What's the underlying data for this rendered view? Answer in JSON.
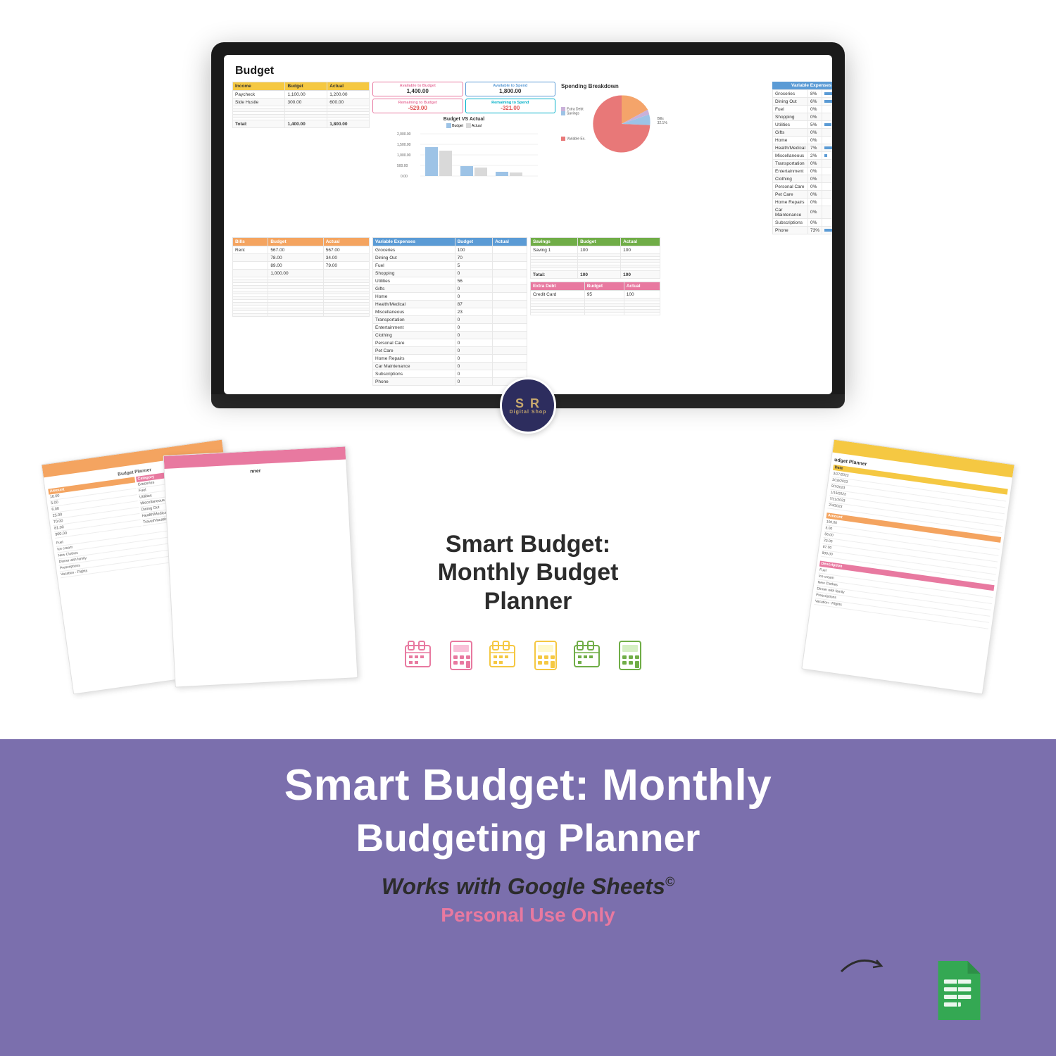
{
  "page": {
    "background": "#ffffff"
  },
  "banner": {
    "line1": "Smart Budget: Monthly",
    "line2": "Budgeting Planner",
    "italic": "Works with Google Sheets",
    "trademark": "©",
    "personal": "Personal Use Only"
  },
  "product_title": {
    "line1": "Smart Budget:",
    "line2": "Monthly Budget",
    "line3": "Planner"
  },
  "logo": {
    "initials": "S R",
    "subtitle": "Digital Shop"
  },
  "spreadsheet": {
    "title": "Budget",
    "income_table": {
      "headers": [
        "Income",
        "Budget",
        "Actual"
      ],
      "rows": [
        [
          "Paycheck",
          "1,100.00",
          "1,200.00"
        ],
        [
          "Side Hustle",
          "300.00",
          "600.00"
        ]
      ],
      "total": [
        "Total:",
        "1,400.00",
        "1,800.00"
      ]
    },
    "bills_table": {
      "headers": [
        "Bills",
        "Budget",
        "Actual"
      ],
      "rows": [
        [
          "Rent",
          "567.00",
          "567.00"
        ],
        [
          "",
          "78.00",
          "34.00"
        ],
        [
          "",
          "89.00",
          "79.00"
        ],
        [
          "",
          "1,000.00",
          ""
        ]
      ]
    },
    "variable_expenses": {
      "headers": [
        "Variable Expenses",
        "Budget",
        "Actual"
      ],
      "rows": [
        [
          "Groceries",
          "100",
          ""
        ],
        [
          "Dining Out",
          "70",
          ""
        ],
        [
          "Fuel",
          "5",
          ""
        ],
        [
          "Shopping",
          "0",
          ""
        ],
        [
          "Utilities",
          "56",
          ""
        ],
        [
          "Gifts",
          "0",
          ""
        ],
        [
          "Home",
          "0",
          ""
        ],
        [
          "Health/Medical",
          "87",
          ""
        ],
        [
          "Miscellaneous",
          "23",
          ""
        ],
        [
          "Transportation",
          "0",
          ""
        ],
        [
          "Entertainment",
          "0",
          ""
        ],
        [
          "Clothing",
          "0",
          ""
        ],
        [
          "Personal Care",
          "0",
          ""
        ],
        [
          "Pet Care",
          "0",
          ""
        ],
        [
          "Home Repairs",
          "0",
          ""
        ],
        [
          "Car Maintenance",
          "0",
          ""
        ],
        [
          "Subscriptions",
          "0",
          ""
        ],
        [
          "Phone",
          "0",
          ""
        ]
      ]
    },
    "savings_table": {
      "headers": [
        "Savings",
        "Budget",
        "Actual"
      ],
      "rows": [
        [
          "Saving 1",
          "100",
          "100"
        ]
      ],
      "total": [
        "Total:",
        "100",
        "100"
      ]
    },
    "extra_debt": {
      "headers": [
        "Extra Debt",
        "Budget",
        "Actual"
      ],
      "rows": [
        [
          "Credit Card",
          "95",
          "100"
        ]
      ]
    },
    "summary": {
      "available_to_budget_label": "Available to Budget",
      "available_to_budget_value": "1,400.00",
      "available_to_spend_label": "Available to Spend",
      "available_to_spend_value": "1,800.00",
      "remaining_to_budget_label": "Remaining to Budget",
      "remaining_to_budget_value": "-529.00",
      "remaining_to_spend_label": "Remaining to Spend",
      "remaining_to_spend_value": "-321.00"
    },
    "chart": {
      "title": "Budget VS Actual",
      "budget_label": "Budget",
      "actual_label": "Actual",
      "y_labels": [
        "2,000.00",
        "1,500.00",
        "1,000.00",
        "500.00",
        "0.00"
      ]
    },
    "pie_chart": {
      "title": "Spending Breakdown",
      "segments": [
        {
          "label": "Bills",
          "value": 32.1,
          "color": "#f4a46a"
        },
        {
          "label": "Variable Ex.",
          "value": 59.5,
          "color": "#e87878"
        },
        {
          "label": "Savings",
          "value": 4.7,
          "color": "#9dc3e6"
        },
        {
          "label": "Extra Debt",
          "value": 0.7,
          "color": "#c9b1d9"
        }
      ]
    },
    "var_breakdown": {
      "header": "Variable Expenses Breakdown",
      "rows": [
        {
          "label": "Groceries",
          "pct": "8%",
          "bar": 8
        },
        {
          "label": "Dining Out",
          "pct": "6%",
          "bar": 6
        },
        {
          "label": "Fuel",
          "pct": "0%",
          "bar": 0
        },
        {
          "label": "Shopping",
          "pct": "0%",
          "bar": 0
        },
        {
          "label": "Utilities",
          "pct": "5%",
          "bar": 5
        },
        {
          "label": "Gifts",
          "pct": "0%",
          "bar": 0
        },
        {
          "label": "Home",
          "pct": "0%",
          "bar": 0
        },
        {
          "label": "Health/Medical",
          "pct": "7%",
          "bar": 7
        },
        {
          "label": "Miscellaneous",
          "pct": "2%",
          "bar": 2
        },
        {
          "label": "Transportation",
          "pct": "0%",
          "bar": 0
        },
        {
          "label": "Entertainment",
          "pct": "0%",
          "bar": 0
        },
        {
          "label": "Clothing",
          "pct": "0%",
          "bar": 0
        },
        {
          "label": "Personal Care",
          "pct": "0%",
          "bar": 0
        },
        {
          "label": "Pet Care",
          "pct": "0%",
          "bar": 0
        },
        {
          "label": "Home Repairs",
          "pct": "0%",
          "bar": 0
        },
        {
          "label": "Car Maintenance",
          "pct": "0%",
          "bar": 0
        },
        {
          "label": "Subscriptions",
          "pct": "0%",
          "bar": 0
        },
        {
          "label": "Phone",
          "pct": "73%",
          "bar": 73
        }
      ]
    }
  },
  "pages_visible": [
    {
      "label": "budget planner page 1"
    },
    {
      "label": "budget planner page 2"
    },
    {
      "label": "budget planner page 3"
    }
  ],
  "icons": [
    {
      "name": "budget-icon-1",
      "color": "#e879a0"
    },
    {
      "name": "budget-icon-2",
      "color": "#e879a0"
    },
    {
      "name": "budget-icon-3",
      "color": "#f5c842"
    },
    {
      "name": "budget-icon-4",
      "color": "#f5c842"
    },
    {
      "name": "budget-icon-5",
      "color": "#70ad47"
    },
    {
      "name": "budget-icon-6",
      "color": "#70ad47"
    }
  ]
}
